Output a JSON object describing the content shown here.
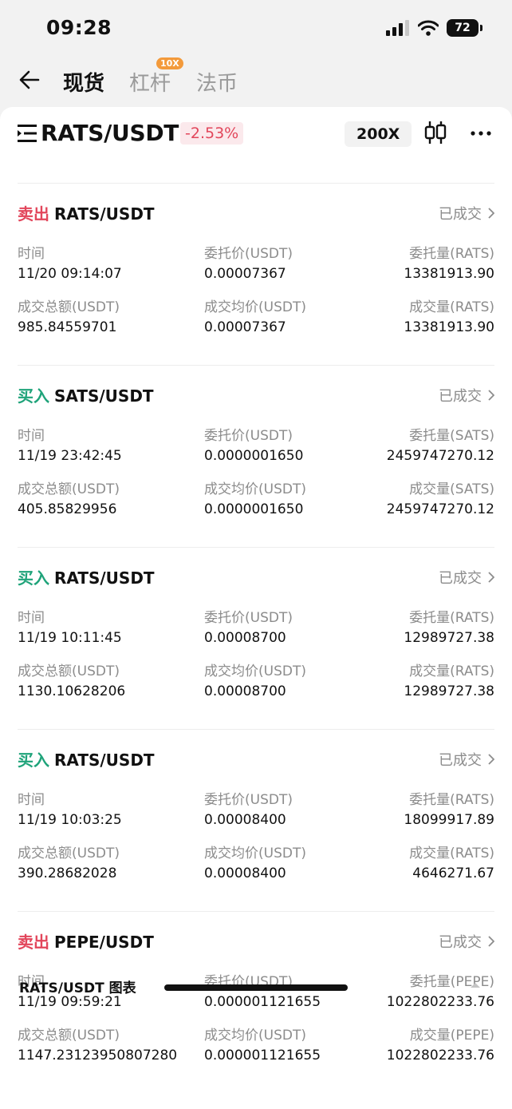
{
  "status_bar": {
    "time": "09:28",
    "battery": "72"
  },
  "nav": {
    "tabs": [
      {
        "label": "现货",
        "active": true
      },
      {
        "label": "杠杆",
        "active": false
      },
      {
        "label": "法币",
        "active": false
      }
    ],
    "leverage_badge": "10X"
  },
  "pair_header": {
    "pair": "RATS/USDT",
    "change": "-2.53%",
    "leverage": "200X"
  },
  "orders": [
    {
      "side": "卖出",
      "side_type": "sell",
      "pair": "RATS/USDT",
      "status": "已成交",
      "labels": [
        "时间",
        "委托价(USDT)",
        "委托量(RATS)",
        "成交总额(USDT)",
        "成交均价(USDT)",
        "成交量(RATS)"
      ],
      "values": [
        "11/20 09:14:07",
        "0.00007367",
        "13381913.90",
        "985.84559701",
        "0.00007367",
        "13381913.90"
      ]
    },
    {
      "side": "买入",
      "side_type": "buy",
      "pair": "SATS/USDT",
      "status": "已成交",
      "labels": [
        "时间",
        "委托价(USDT)",
        "委托量(SATS)",
        "成交总额(USDT)",
        "成交均价(USDT)",
        "成交量(SATS)"
      ],
      "values": [
        "11/19 23:42:45",
        "0.0000001650",
        "2459747270.12",
        "405.85829956",
        "0.0000001650",
        "2459747270.12"
      ]
    },
    {
      "side": "买入",
      "side_type": "buy",
      "pair": "RATS/USDT",
      "status": "已成交",
      "labels": [
        "时间",
        "委托价(USDT)",
        "委托量(RATS)",
        "成交总额(USDT)",
        "成交均价(USDT)",
        "成交量(RATS)"
      ],
      "values": [
        "11/19 10:11:45",
        "0.00008700",
        "12989727.38",
        "1130.10628206",
        "0.00008700",
        "12989727.38"
      ]
    },
    {
      "side": "买入",
      "side_type": "buy",
      "pair": "RATS/USDT",
      "status": "已成交",
      "labels": [
        "时间",
        "委托价(USDT)",
        "委托量(RATS)",
        "成交总额(USDT)",
        "成交均价(USDT)",
        "成交量(RATS)"
      ],
      "values": [
        "11/19 10:03:25",
        "0.00008400",
        "18099917.89",
        "390.28682028",
        "0.00008400",
        "4646271.67"
      ]
    },
    {
      "side": "卖出",
      "side_type": "sell",
      "pair": "PEPE/USDT",
      "status": "已成交",
      "labels": [
        "时间",
        "委托价(USDT)",
        "委托量(PEPE)",
        "成交总额(USDT)",
        "成交均价(USDT)",
        "成交量(PEPE)"
      ],
      "values": [
        "11/19 09:59:21",
        "0.000001121655",
        "1022802233.76",
        "1147.23123950807280",
        "0.000001121655",
        "1022802233.76"
      ]
    }
  ],
  "footer": {
    "title": "RATS/USDT 图表"
  },
  "colors": {
    "sell": "#e2465b",
    "buy": "#1fa37a",
    "badge": "#f39a3b"
  },
  "icons": [
    "back-arrow-icon",
    "menu-icon",
    "candlestick-icon",
    "more-icon",
    "chevron-right-icon",
    "signal-icon",
    "wifi-icon",
    "battery-icon",
    "collapse-icon"
  ]
}
